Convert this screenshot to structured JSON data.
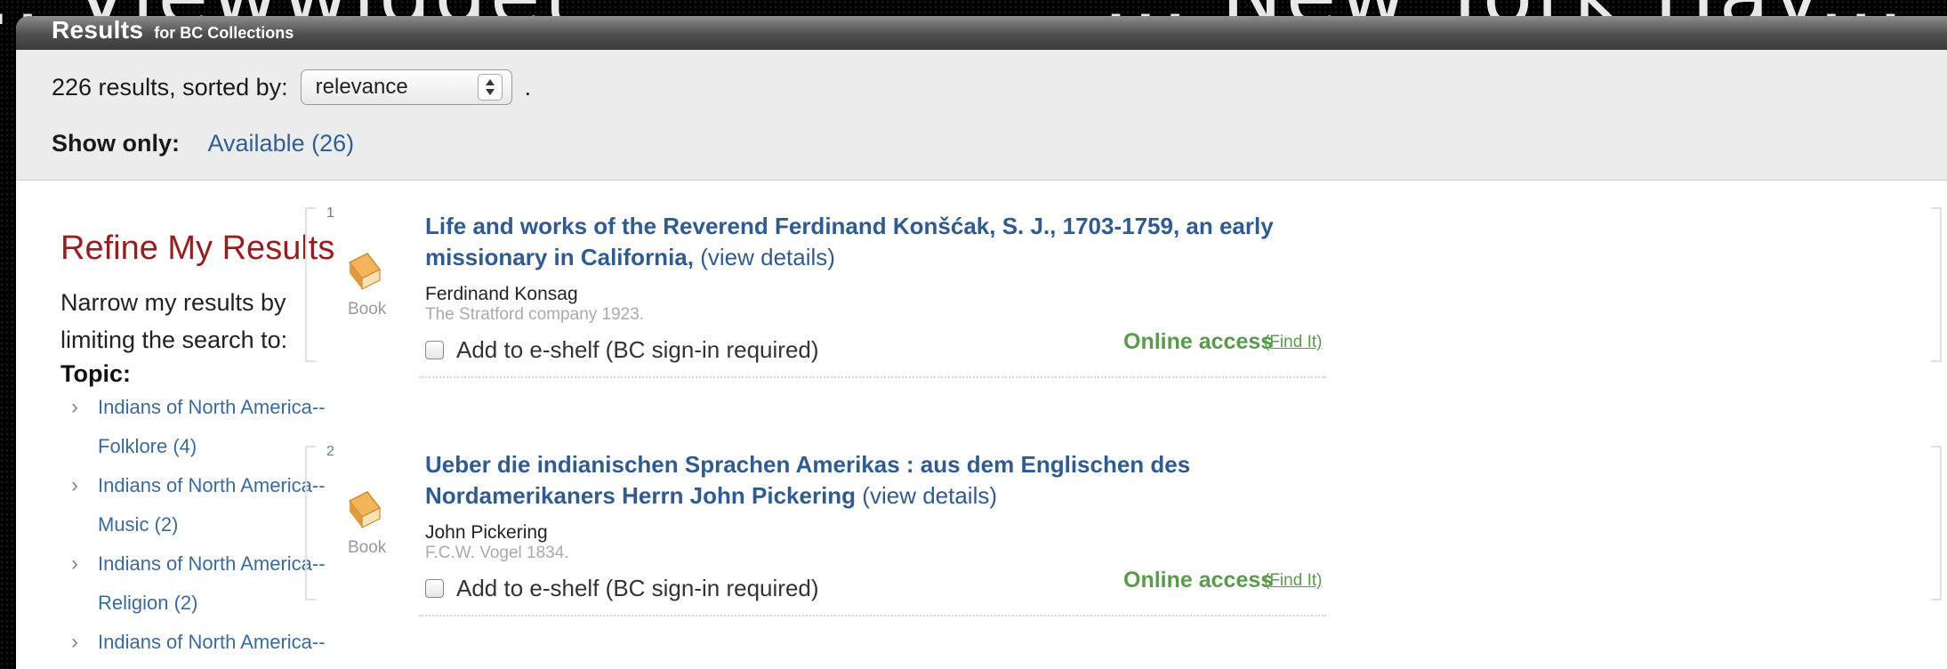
{
  "background_banner": {
    "left_fragment": "...  Viewwidget",
    "right_fragment": "... New York Hav..."
  },
  "header": {
    "title": "Results",
    "subtitle": "for BC Collections"
  },
  "results_bar": {
    "count_text": "226 results, sorted by:",
    "sort_value": "relevance",
    "trailing": ".",
    "show_only_label": "Show only:",
    "show_only_link": "Available (26)"
  },
  "sidebar": {
    "title": "Refine My Results",
    "description": "Narrow my results by limiting the search to:",
    "topic_label": "Topic:",
    "facets": [
      {
        "line1": "Indians of North America--",
        "line2": "Folklore (4)"
      },
      {
        "line1": "Indians of North America--",
        "line2": "Music (2)"
      },
      {
        "line1": "Indians of North America--",
        "line2": "Religion (2)"
      },
      {
        "line1": "Indians of North America--",
        "line2": ""
      }
    ]
  },
  "results": [
    {
      "number": "1",
      "type": "Book",
      "title": "Life and works of the Reverend Ferdinand Konšćak, S. J., 1703-1759, an early missionary in California,",
      "details_link": "(view details)",
      "author": "Ferdinand Konsag",
      "publisher": "The Stratford company 1923.",
      "eshelf_label": "Add to e-shelf (BC sign-in required)",
      "access": "Online access",
      "find_it": "(Find It)"
    },
    {
      "number": "2",
      "type": "Book",
      "title": "Ueber die indianischen Sprachen Amerikas : aus dem Englischen des Nordamerikaners Herrn John Pickering",
      "details_link": "(view details)",
      "author": "John Pickering",
      "publisher": "F.C.W. Vogel 1834.",
      "eshelf_label": "Add to e-shelf (BC sign-in required)",
      "access": "Online access",
      "find_it": "(Find It)"
    }
  ],
  "colors": {
    "link_blue": "#2f5b94",
    "refine_red": "#9b1c1c",
    "access_green": "#5a9b4b",
    "book_icon": "#f0a94a"
  }
}
